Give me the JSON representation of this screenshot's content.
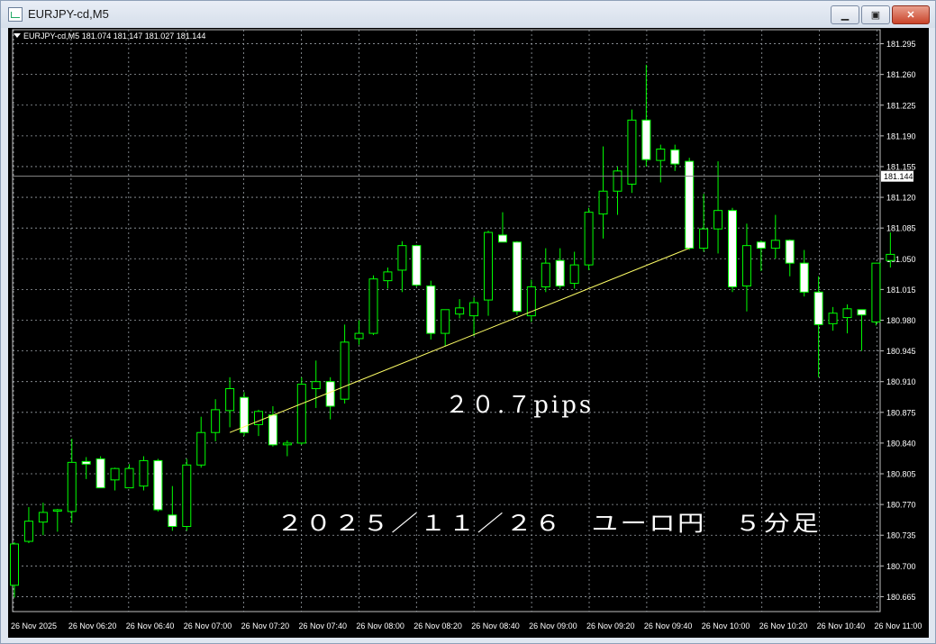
{
  "window": {
    "title": "EURJPY-cd,M5",
    "buttons": {
      "minimize": "▁",
      "restore": "▣",
      "close": "✕"
    }
  },
  "colors": {
    "background": "#000000",
    "grid": "#9aa0a6",
    "bull_candle": "#00ff00",
    "body": "#ffffff",
    "trendline": "#ffff66",
    "text": "#ffffff"
  },
  "chart_data": {
    "type": "candlestick",
    "symbol_header": "EURJPY-cd,M5  181.074 181.147 181.027 181.144",
    "current_price_label": "181.144",
    "current_price": 181.144,
    "ylim": [
      180.648,
      181.313
    ],
    "y_ticks": [
      "181.295",
      "181.260",
      "181.225",
      "181.190",
      "181.155",
      "181.120",
      "181.085",
      "181.050",
      "181.015",
      "180.980",
      "180.945",
      "180.910",
      "180.875",
      "180.840",
      "180.805",
      "180.770",
      "180.735",
      "180.700",
      "180.665"
    ],
    "x_ticks": [
      "26 Nov 2025",
      "26 Nov 06:20",
      "26 Nov 06:40",
      "26 Nov 07:00",
      "26 Nov 07:20",
      "26 Nov 07:40",
      "26 Nov 08:00",
      "26 Nov 08:20",
      "26 Nov 08:40",
      "26 Nov 09:00",
      "26 Nov 09:20",
      "26 Nov 09:40",
      "26 Nov 10:00",
      "26 Nov 10:20",
      "26 Nov 10:40",
      "26 Nov 11:00"
    ],
    "candles": [
      {
        "o": 180.678,
        "h": 180.727,
        "l": 180.664,
        "c": 180.725
      },
      {
        "o": 180.728,
        "h": 180.767,
        "l": 180.726,
        "c": 180.751
      },
      {
        "o": 180.75,
        "h": 180.772,
        "l": 180.735,
        "c": 180.761
      },
      {
        "o": 180.763,
        "h": 180.765,
        "l": 180.739,
        "c": 180.764
      },
      {
        "o": 180.762,
        "h": 180.845,
        "l": 180.749,
        "c": 180.818
      },
      {
        "o": 180.819,
        "h": 180.824,
        "l": 180.799,
        "c": 180.816
      },
      {
        "o": 180.822,
        "h": 180.825,
        "l": 180.794,
        "c": 180.789
      },
      {
        "o": 180.798,
        "h": 180.812,
        "l": 180.786,
        "c": 180.811
      },
      {
        "o": 180.789,
        "h": 180.816,
        "l": 180.791,
        "c": 180.811
      },
      {
        "o": 180.791,
        "h": 180.825,
        "l": 180.786,
        "c": 180.82
      },
      {
        "o": 180.82,
        "h": 180.822,
        "l": 180.762,
        "c": 180.764
      },
      {
        "o": 180.758,
        "h": 180.791,
        "l": 180.74,
        "c": 180.745
      },
      {
        "o": 180.745,
        "h": 180.822,
        "l": 180.74,
        "c": 180.815
      },
      {
        "o": 180.815,
        "h": 180.87,
        "l": 180.812,
        "c": 180.852
      },
      {
        "o": 180.852,
        "h": 180.89,
        "l": 180.842,
        "c": 180.878
      },
      {
        "o": 180.877,
        "h": 180.915,
        "l": 180.858,
        "c": 180.902
      },
      {
        "o": 180.892,
        "h": 180.898,
        "l": 180.848,
        "c": 180.852
      },
      {
        "o": 180.861,
        "h": 180.878,
        "l": 180.848,
        "c": 180.876
      },
      {
        "o": 180.872,
        "h": 180.882,
        "l": 180.836,
        "c": 180.838
      },
      {
        "o": 180.838,
        "h": 180.843,
        "l": 180.825,
        "c": 180.84
      },
      {
        "o": 180.84,
        "h": 180.915,
        "l": 180.838,
        "c": 180.907
      },
      {
        "o": 180.902,
        "h": 180.934,
        "l": 180.88,
        "c": 180.91
      },
      {
        "o": 180.91,
        "h": 180.915,
        "l": 180.867,
        "c": 180.882
      },
      {
        "o": 180.89,
        "h": 180.975,
        "l": 180.885,
        "c": 180.955
      },
      {
        "o": 180.959,
        "h": 180.98,
        "l": 180.952,
        "c": 180.965
      },
      {
        "o": 180.965,
        "h": 181.031,
        "l": 180.963,
        "c": 181.027
      },
      {
        "o": 181.025,
        "h": 181.04,
        "l": 181.016,
        "c": 181.035
      },
      {
        "o": 181.037,
        "h": 181.07,
        "l": 181.012,
        "c": 181.065
      },
      {
        "o": 181.065,
        "h": 181.066,
        "l": 181.018,
        "c": 181.02
      },
      {
        "o": 181.019,
        "h": 181.025,
        "l": 180.958,
        "c": 180.965
      },
      {
        "o": 180.965,
        "h": 180.992,
        "l": 180.95,
        "c": 180.992
      },
      {
        "o": 180.987,
        "h": 181.004,
        "l": 180.982,
        "c": 180.994
      },
      {
        "o": 180.985,
        "h": 181.006,
        "l": 180.962,
        "c": 181.0
      },
      {
        "o": 181.003,
        "h": 181.082,
        "l": 180.985,
        "c": 181.08
      },
      {
        "o": 181.077,
        "h": 181.103,
        "l": 181.07,
        "c": 181.069
      },
      {
        "o": 181.069,
        "h": 181.07,
        "l": 180.986,
        "c": 180.99
      },
      {
        "o": 180.985,
        "h": 181.026,
        "l": 180.978,
        "c": 181.018
      },
      {
        "o": 181.018,
        "h": 181.062,
        "l": 181.012,
        "c": 181.045
      },
      {
        "o": 181.048,
        "h": 181.062,
        "l": 181.016,
        "c": 181.019
      },
      {
        "o": 181.022,
        "h": 181.058,
        "l": 181.016,
        "c": 181.043
      },
      {
        "o": 181.043,
        "h": 181.108,
        "l": 181.037,
        "c": 181.103
      },
      {
        "o": 181.101,
        "h": 181.178,
        "l": 181.073,
        "c": 181.127
      },
      {
        "o": 181.127,
        "h": 181.155,
        "l": 181.1,
        "c": 181.15
      },
      {
        "o": 181.135,
        "h": 181.22,
        "l": 181.125,
        "c": 181.208
      },
      {
        "o": 181.208,
        "h": 181.271,
        "l": 181.155,
        "c": 181.163
      },
      {
        "o": 181.162,
        "h": 181.18,
        "l": 181.137,
        "c": 181.175
      },
      {
        "o": 181.174,
        "h": 181.18,
        "l": 181.15,
        "c": 181.158
      },
      {
        "o": 181.161,
        "h": 181.165,
        "l": 181.06,
        "c": 181.062
      },
      {
        "o": 181.062,
        "h": 181.124,
        "l": 181.058,
        "c": 181.084
      },
      {
        "o": 181.084,
        "h": 181.161,
        "l": 181.056,
        "c": 181.105
      },
      {
        "o": 181.105,
        "h": 181.108,
        "l": 181.012,
        "c": 181.018
      },
      {
        "o": 181.019,
        "h": 181.09,
        "l": 180.99,
        "c": 181.065
      },
      {
        "o": 181.069,
        "h": 181.071,
        "l": 181.036,
        "c": 181.062
      },
      {
        "o": 181.062,
        "h": 181.1,
        "l": 181.05,
        "c": 181.071
      },
      {
        "o": 181.071,
        "h": 181.072,
        "l": 181.03,
        "c": 181.045
      },
      {
        "o": 181.045,
        "h": 181.06,
        "l": 181.007,
        "c": 181.012
      },
      {
        "o": 181.012,
        "h": 181.03,
        "l": 180.915,
        "c": 180.975
      },
      {
        "o": 180.976,
        "h": 180.995,
        "l": 180.968,
        "c": 180.988
      },
      {
        "o": 180.983,
        "h": 180.998,
        "l": 180.965,
        "c": 180.993
      },
      {
        "o": 180.992,
        "h": 180.988,
        "l": 180.945,
        "c": 180.986
      },
      {
        "o": 180.978,
        "h": 181.045,
        "l": 180.974,
        "c": 181.045
      },
      {
        "o": 181.048,
        "h": 181.08,
        "l": 181.04,
        "c": 181.055
      }
    ],
    "trendline": {
      "from": {
        "index": 15,
        "price": 180.852
      },
      "to": {
        "index": 47,
        "price": 181.062
      }
    },
    "annotations": {
      "pips": "２０.７pips",
      "caption": "２０２５／１１／２６　ユーロ円　５分足"
    }
  }
}
